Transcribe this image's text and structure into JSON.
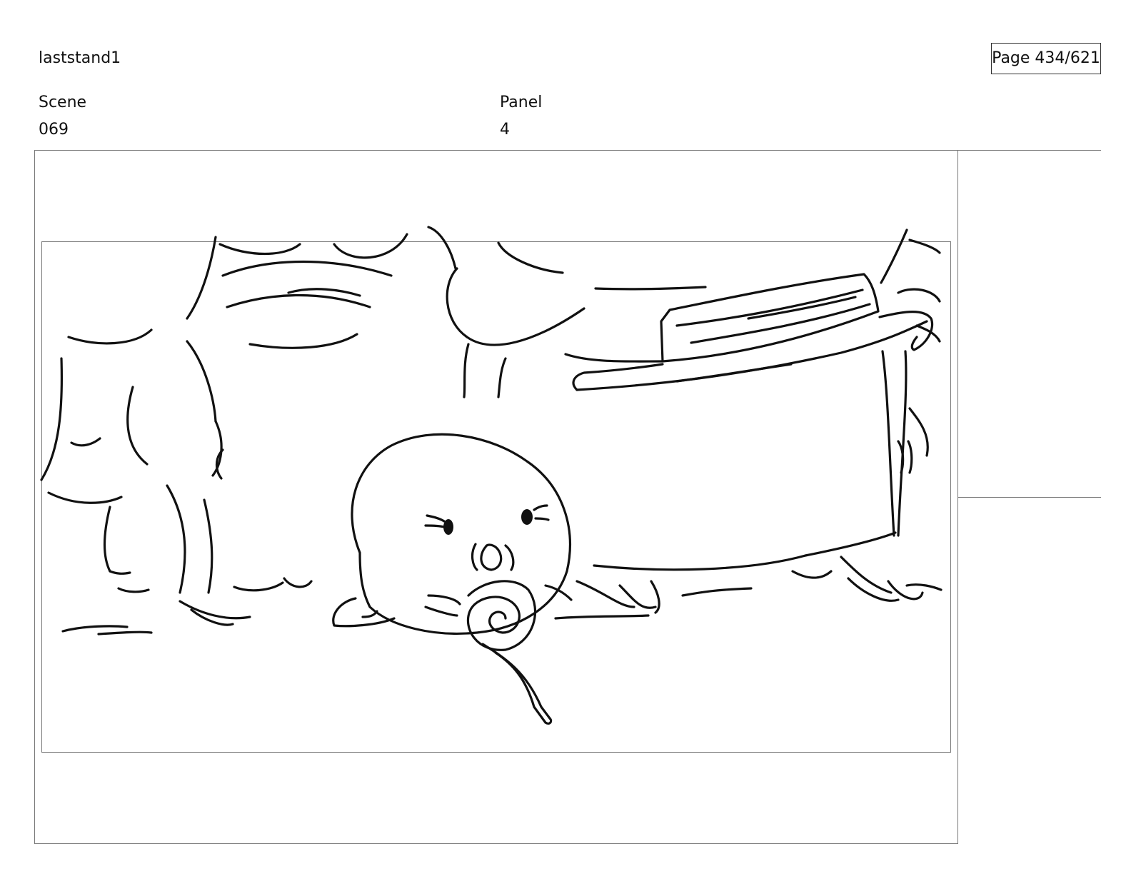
{
  "document": {
    "title": "laststand1",
    "page_counter": "Page 434/621"
  },
  "fields": {
    "scene_label": "Scene",
    "scene_value": "069",
    "panel_label": "Panel",
    "panel_value": "4"
  },
  "colors": {
    "ink": "#111111",
    "frame_border": "#777777",
    "background": "#ffffff"
  }
}
